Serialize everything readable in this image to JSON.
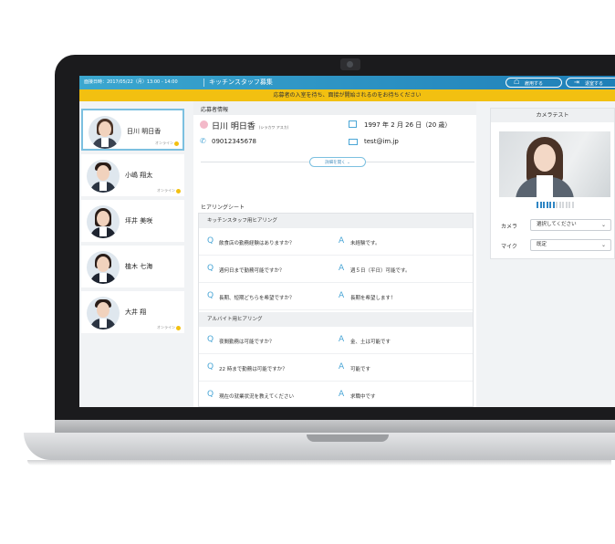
{
  "topbar": {
    "interview_datetime": "面接日時：2017/05/22（月）13:00 - 14:00",
    "job_title": "キッチンスタッフ募集",
    "hire_button": "雇用する",
    "leave_button": "退室する"
  },
  "banner": {
    "text": "応募者の入室を待ち、面接が開始されるのをお待ちください"
  },
  "candidates": [
    {
      "name": "日川 明日香",
      "status": "オンライン",
      "selected": true
    },
    {
      "name": "小嶋 翔太",
      "status": "オンライン",
      "selected": false
    },
    {
      "name": "坪井 美咲",
      "status": "",
      "selected": false
    },
    {
      "name": "植木 七海",
      "status": "",
      "selected": false
    },
    {
      "name": "大井 翔",
      "status": "オンライン",
      "selected": false
    }
  ],
  "applicant": {
    "section_title": "応募者情報",
    "name": "日川 明日香",
    "kana": "(シラカワ アスカ)",
    "birthdate": "1997 年 2 月 26 日（20 歳）",
    "phone": "09012345678",
    "email": "test@im.jp",
    "details_button": "詳細を開く"
  },
  "hearing": {
    "section_title": "ヒアリングシート",
    "groups": [
      {
        "title": "キッチンスタッフ用ヒアリング",
        "items": [
          {
            "q": "飲食店の勤務経験はありますか？",
            "a": "未経験です。"
          },
          {
            "q": "週何日まで勤務可能ですか？",
            "a": "週５日（平日）可能です。"
          },
          {
            "q": "長期、短期どちらを希望ですか？",
            "a": "長期を希望します！"
          }
        ]
      },
      {
        "title": "アルバイト用ヒアリング",
        "items": [
          {
            "q": "夜間勤務は可能ですか？",
            "a": "金、土は可能です"
          },
          {
            "q": "22 時まで勤務は可能ですか？",
            "a": "可能です"
          },
          {
            "q": "現在の就業状況を教えてください",
            "a": "求職中です"
          }
        ]
      }
    ],
    "q_mark": "Q",
    "a_mark": "A"
  },
  "camera_test": {
    "title": "カメラテスト",
    "mic_level_fraction": 0.5,
    "camera_label": "カメラ",
    "camera_value": "選択してください",
    "mic_label": "マイク",
    "mic_value": "既定"
  },
  "colors": {
    "topbar": "#2a93c6",
    "banner": "#f2c011",
    "accent": "#4aa6d6",
    "online": "#f2c011"
  }
}
